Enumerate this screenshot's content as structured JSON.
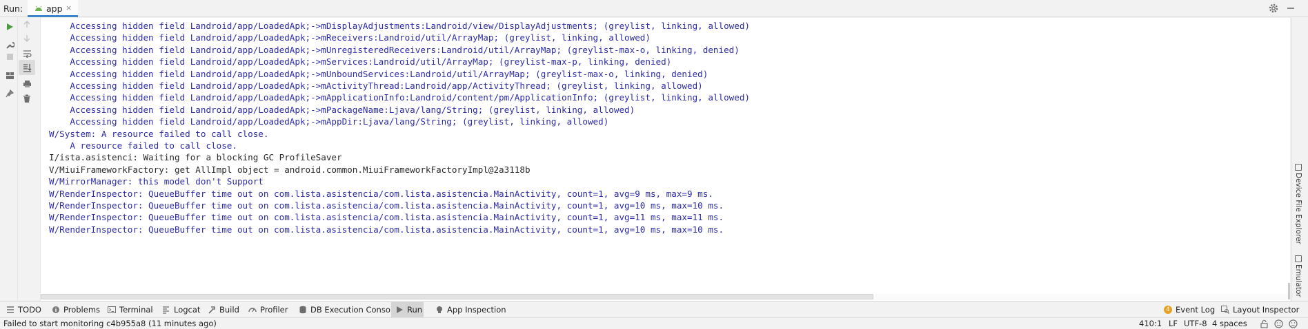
{
  "run_bar": {
    "label": "Run:",
    "tab_label": "app",
    "tab_close": "×"
  },
  "console_lines": [
    {
      "text": "    Accessing hidden field Landroid/app/LoadedApk;->mDisplayAdjustments:Landroid/view/DisplayAdjustments; (greylist, linking, allowed)",
      "level": "blue"
    },
    {
      "text": "    Accessing hidden field Landroid/app/LoadedApk;->mReceivers:Landroid/util/ArrayMap; (greylist, linking, allowed)",
      "level": "blue"
    },
    {
      "text": "    Accessing hidden field Landroid/app/LoadedApk;->mUnregisteredReceivers:Landroid/util/ArrayMap; (greylist-max-o, linking, denied)",
      "level": "blue"
    },
    {
      "text": "    Accessing hidden field Landroid/app/LoadedApk;->mServices:Landroid/util/ArrayMap; (greylist-max-p, linking, denied)",
      "level": "blue"
    },
    {
      "text": "    Accessing hidden field Landroid/app/LoadedApk;->mUnboundServices:Landroid/util/ArrayMap; (greylist-max-o, linking, denied)",
      "level": "blue"
    },
    {
      "text": "    Accessing hidden field Landroid/app/LoadedApk;->mActivityThread:Landroid/app/ActivityThread; (greylist, linking, allowed)",
      "level": "blue"
    },
    {
      "text": "    Accessing hidden field Landroid/app/LoadedApk;->mApplicationInfo:Landroid/content/pm/ApplicationInfo; (greylist, linking, allowed)",
      "level": "blue"
    },
    {
      "text": "    Accessing hidden field Landroid/app/LoadedApk;->mPackageName:Ljava/lang/String; (greylist, linking, allowed)",
      "level": "blue"
    },
    {
      "text": "    Accessing hidden field Landroid/app/LoadedApk;->mAppDir:Ljava/lang/String; (greylist, linking, allowed)",
      "level": "blue"
    },
    {
      "text": "W/System: A resource failed to call close.",
      "level": "blue"
    },
    {
      "text": "    A resource failed to call close.",
      "level": "blue"
    },
    {
      "text": "I/ista.asistenci: Waiting for a blocking GC ProfileSaver",
      "level": "dark"
    },
    {
      "text": "V/MiuiFrameworkFactory: get AllImpl object = android.common.MiuiFrameworkFactoryImpl@2a3118b",
      "level": "dark"
    },
    {
      "text": "W/MirrorManager: this model don't Support",
      "level": "blue"
    },
    {
      "text": "W/RenderInspector: QueueBuffer time out on com.lista.asistencia/com.lista.asistencia.MainActivity, count=1, avg=9 ms, max=9 ms.",
      "level": "blue"
    },
    {
      "text": "W/RenderInspector: QueueBuffer time out on com.lista.asistencia/com.lista.asistencia.MainActivity, count=1, avg=10 ms, max=10 ms.",
      "level": "blue"
    },
    {
      "text": "W/RenderInspector: QueueBuffer time out on com.lista.asistencia/com.lista.asistencia.MainActivity, count=1, avg=11 ms, max=11 ms.",
      "level": "blue"
    },
    {
      "text": "W/RenderInspector: QueueBuffer time out on com.lista.asistencia/com.lista.asistencia.MainActivity, count=1, avg=10 ms, max=10 ms.",
      "level": "blue"
    }
  ],
  "right_strip": {
    "device_file_explorer": "Device File Explorer",
    "emulator": "Emulator"
  },
  "tool_windows": {
    "todo": "TODO",
    "problems": "Problems",
    "terminal": "Terminal",
    "logcat": "Logcat",
    "build": "Build",
    "profiler": "Profiler",
    "db_console": "DB Execution Console",
    "run": "Run",
    "app_inspection": "App Inspection",
    "event_log": "Event Log",
    "event_log_count": "4",
    "layout_inspector": "Layout Inspector"
  },
  "status": {
    "message": "Failed to start monitoring c4b955a8 (11 minutes ago)",
    "position": "410:1",
    "line_sep": "LF",
    "encoding": "UTF-8",
    "indent": "4 spaces"
  },
  "colors": {
    "accent": "#4083c9",
    "log_blue": "#2c2ca8",
    "log_dark": "#2a2a2a",
    "run_green": "#4a9c3f"
  },
  "icons": [
    "android-icon",
    "gear-icon",
    "minimize-icon",
    "run-icon",
    "wrench-icon",
    "stop-icon",
    "layout-icon",
    "pin-icon",
    "arrow-up-icon",
    "arrow-down-icon",
    "soft-wrap-icon",
    "scroll-to-end-icon",
    "print-icon",
    "trash-icon"
  ]
}
